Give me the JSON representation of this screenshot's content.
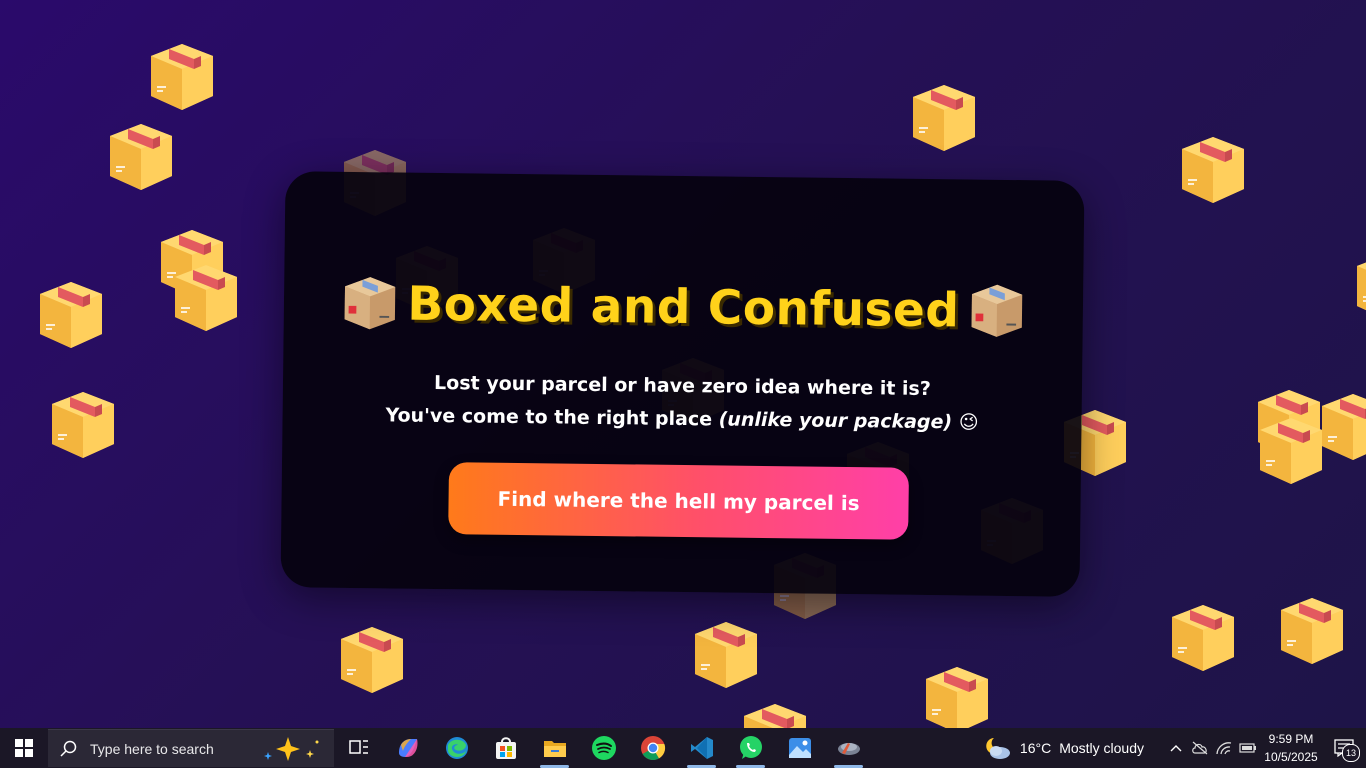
{
  "app": {
    "title": "Boxed and Confused",
    "title_emoji": "package-icon",
    "subtitle_line1": "Lost your parcel or have zero idea where it is?",
    "subtitle_line2_main": "You've come to the right place ",
    "subtitle_line2_italic": "(unlike your package)",
    "subtitle_emoji": "😉",
    "cta_label": "Find where the hell my parcel is"
  },
  "colors": {
    "background": "#261060",
    "title": "#ffd21a",
    "cta_start": "#ff7a1a",
    "cta_end": "#ff3fa8",
    "box_body": "#fcc54f",
    "box_tape": "#e35a5f"
  },
  "taskbar": {
    "search_placeholder": "Type here to search",
    "apps": [
      {
        "name": "task-view",
        "icon": "task-view-icon"
      },
      {
        "name": "copilot",
        "icon": "copilot-icon"
      },
      {
        "name": "edge",
        "icon": "edge-icon"
      },
      {
        "name": "store",
        "icon": "store-icon"
      },
      {
        "name": "file-explorer",
        "icon": "folder-icon"
      },
      {
        "name": "spotify",
        "icon": "spotify-icon"
      },
      {
        "name": "chrome",
        "icon": "chrome-icon"
      },
      {
        "name": "vscode",
        "icon": "vscode-icon"
      },
      {
        "name": "whatsapp",
        "icon": "whatsapp-icon"
      },
      {
        "name": "photos",
        "icon": "photos-icon"
      },
      {
        "name": "app-running",
        "icon": "satellite-icon"
      }
    ],
    "weather_temp": "16°C",
    "weather_desc": "Mostly cloudy",
    "time": "9:59 PM",
    "date": "10/5/2025",
    "notification_count": "13"
  }
}
